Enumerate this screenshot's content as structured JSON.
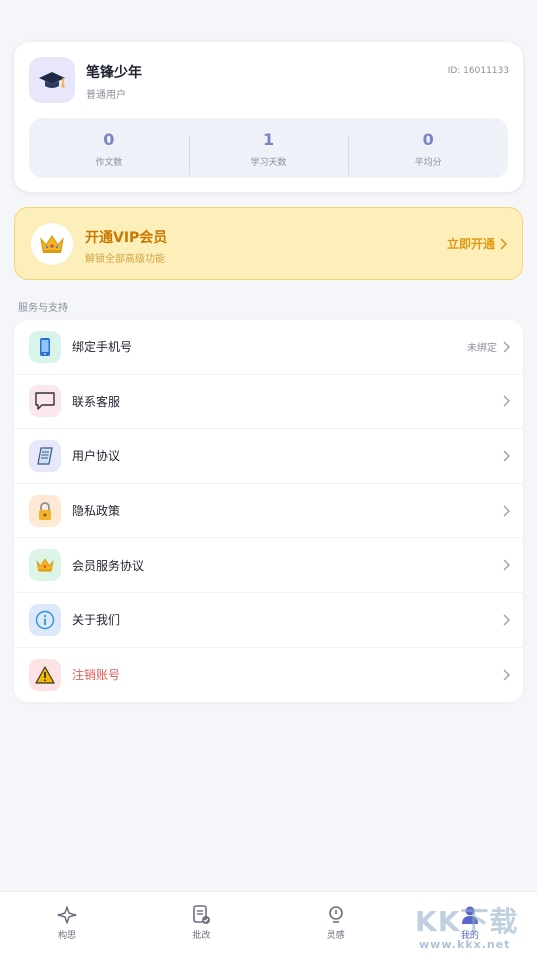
{
  "profile": {
    "username": "笔锋少年",
    "user_type": "普通用户",
    "user_id": "ID: 16011133",
    "stats": [
      {
        "value": "0",
        "label": "作文数"
      },
      {
        "value": "1",
        "label": "学习天数"
      },
      {
        "value": "0",
        "label": "平均分"
      }
    ]
  },
  "vip": {
    "title": "开通VIP会员",
    "subtitle": "解锁全部高级功能",
    "action": "立即开通"
  },
  "section_title": "服务与支持",
  "menu": [
    {
      "label": "绑定手机号",
      "status": "未绑定",
      "icon": "phone-icon"
    },
    {
      "label": "联系客服",
      "status": "",
      "icon": "chat-icon"
    },
    {
      "label": "用户协议",
      "status": "",
      "icon": "document-icon"
    },
    {
      "label": "隐私政策",
      "status": "",
      "icon": "lock-icon"
    },
    {
      "label": "会员服务协议",
      "status": "",
      "icon": "crown-icon"
    },
    {
      "label": "关于我们",
      "status": "",
      "icon": "info-icon"
    },
    {
      "label": "注销账号",
      "status": "",
      "icon": "warning-icon"
    }
  ],
  "tabs": [
    {
      "label": "构思",
      "icon": "sparkle-icon"
    },
    {
      "label": "批改",
      "icon": "review-icon"
    },
    {
      "label": "灵感",
      "icon": "bulb-icon"
    },
    {
      "label": "我的",
      "icon": "user-icon",
      "active": true
    }
  ],
  "watermark": {
    "text": "KK下载",
    "url": "www.kkx.net"
  },
  "colors": {
    "accent": "#5b66c9",
    "vip": "#c87a00",
    "danger": "#e45a5a"
  }
}
